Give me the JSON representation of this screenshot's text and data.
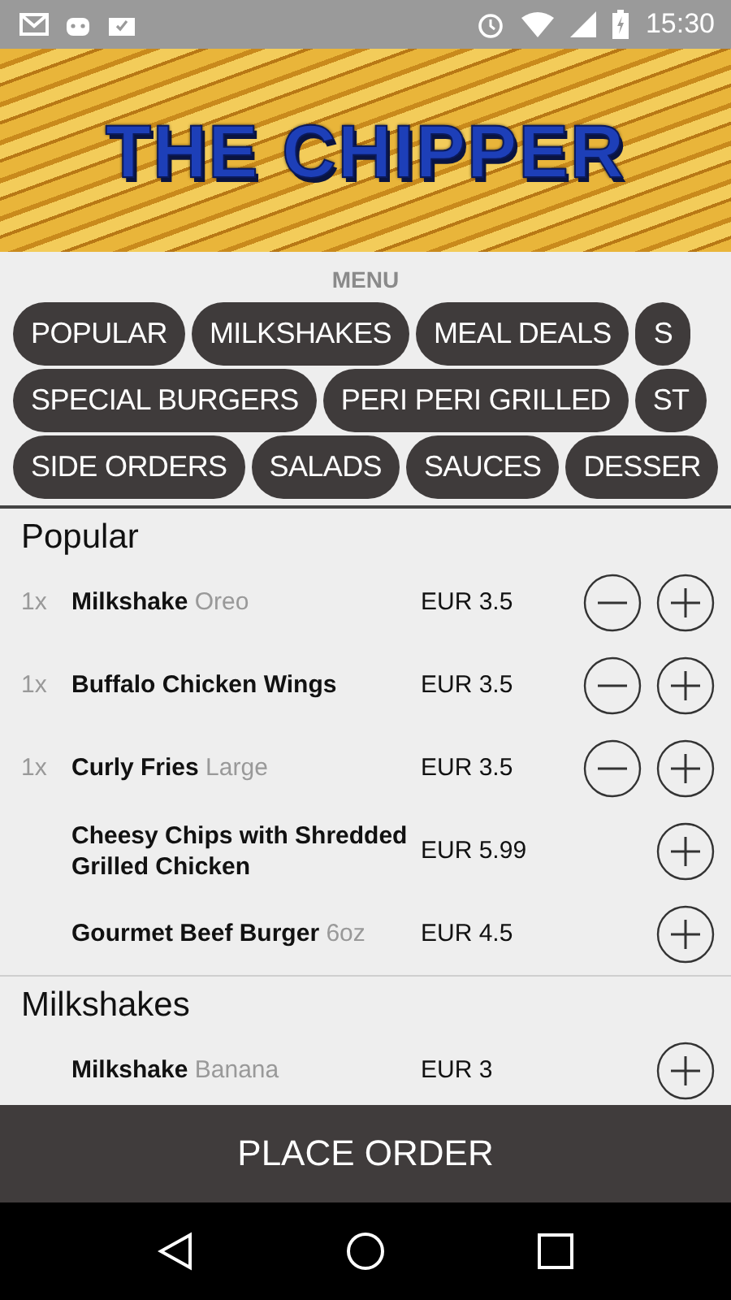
{
  "status_bar": {
    "time": "15:30"
  },
  "banner": {
    "title": "THE CHIPPER"
  },
  "menu": {
    "label": "MENU",
    "category_rows": [
      [
        "POPULAR",
        "MILKSHAKES",
        "MEAL DEALS",
        "S"
      ],
      [
        "SPECIAL BURGERS",
        "PERI PERI GRILLED",
        "ST"
      ],
      [
        "SIDE ORDERS",
        "SALADS",
        "SAUCES",
        "DESSER"
      ]
    ]
  },
  "sections": [
    {
      "title": "Popular",
      "items": [
        {
          "quantity": "1x",
          "name": "Milkshake",
          "variant": "Oreo",
          "price": "EUR 3.5"
        },
        {
          "quantity": "1x",
          "name": "Buffalo Chicken Wings",
          "price": "EUR 3.5"
        },
        {
          "quantity": "1x",
          "name": "Curly Fries",
          "variant": "Large",
          "price": "EUR 3.5"
        },
        {
          "name": "Cheesy Chips with Shredded Grilled Chicken",
          "price": "EUR 5.99"
        },
        {
          "name": "Gourmet Beef Burger",
          "variant": "6oz",
          "price": "EUR 4.5"
        }
      ]
    },
    {
      "title": "Milkshakes",
      "items": [
        {
          "name": "Milkshake",
          "variant": "Banana",
          "price": "EUR 3"
        }
      ]
    }
  ],
  "order_button": {
    "label": "PLACE ORDER"
  }
}
